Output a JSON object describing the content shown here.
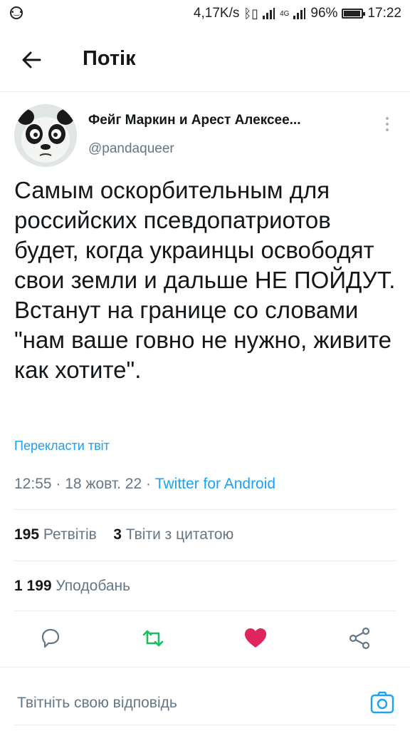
{
  "status_bar": {
    "speed": "4,17K/s",
    "network": "4G",
    "battery": "96%",
    "battery_level": 0.96,
    "time": "17:22"
  },
  "header": {
    "title": "Потік"
  },
  "tweet": {
    "author_name": "Фейг Маркин и Арест Алексее...",
    "handle": "@pandaqueer",
    "text": "Самым оскорбительным для российских псевдопатриотов будет, когда украинцы освободят свои земли и дальше НЕ ПОЙДУТ. Встанут на границе со словами \"нам ваше говно не нужно, живите как хотите\".",
    "translate_label": "Перекласти твіт",
    "time": "12:55",
    "date": "18 жовт. 22",
    "source": "Twitter for Android",
    "retweets_count": "195",
    "retweets_label": "Ретвітів",
    "quotes_count": "3",
    "quotes_label": "Твіти з цитатою",
    "likes_count": "1 199",
    "likes_label": "Уподобань"
  },
  "actions": {
    "icons": [
      "reply-icon",
      "retweet-icon",
      "like-icon",
      "share-icon"
    ],
    "retweet_color": "#17bf63",
    "like_color": "#e0245e"
  },
  "reply": {
    "placeholder": "Твітніть свою відповідь"
  },
  "colors": {
    "accent": "#1da1f2",
    "secondary_text": "#657786",
    "divider": "#e6ecf0"
  }
}
